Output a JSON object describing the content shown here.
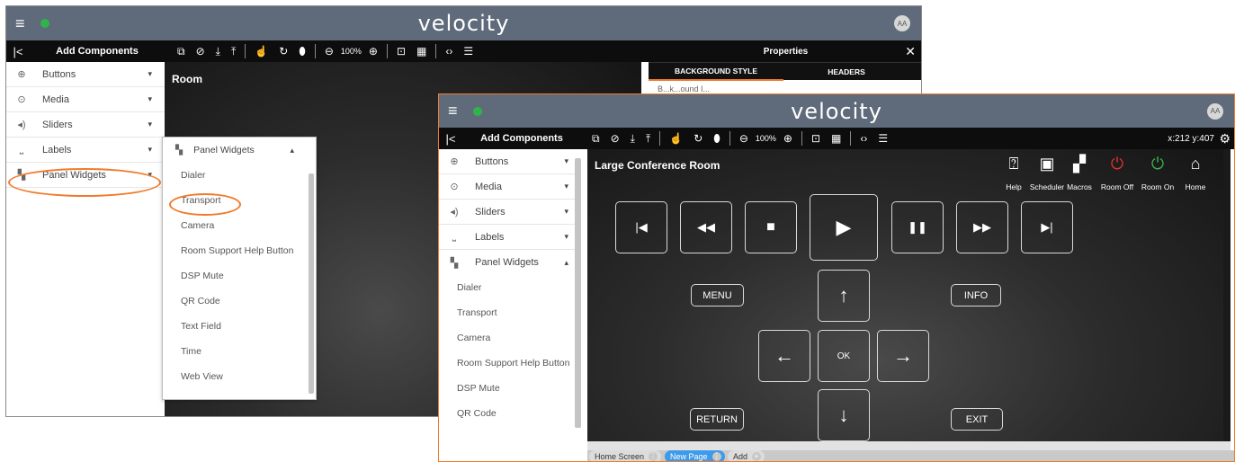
{
  "app": {
    "logo": "velocity",
    "avatar": "AA",
    "menu_glyph": "≡"
  },
  "back_window": {
    "add_components_title": "Add Components",
    "collapse_glyph": "|<",
    "zoom_level": "100%",
    "canvas_title": "Room",
    "properties": {
      "title": "Properties",
      "close_glyph": "✕",
      "tabs": [
        "BACKGROUND STYLE",
        "HEADERS"
      ],
      "partial_text": "B...k...ound I..."
    },
    "sidebar": [
      {
        "label": "Buttons",
        "icon": "plus-circle-icon"
      },
      {
        "label": "Media",
        "icon": "play-circle-icon"
      },
      {
        "label": "Sliders",
        "icon": "volume-icon"
      },
      {
        "label": "Labels",
        "icon": "label-icon"
      },
      {
        "label": "Panel Widgets",
        "icon": "widgets-icon"
      }
    ],
    "popup": {
      "header": "Panel Widgets",
      "items": [
        "Dialer",
        "Transport",
        "Camera",
        "Room Support Help Button",
        "DSP Mute",
        "QR Code",
        "Text Field",
        "Time",
        "Web View"
      ]
    }
  },
  "front_window": {
    "add_components_title": "Add Components",
    "collapse_glyph": "|<",
    "zoom_level": "100%",
    "coords": "x:212 y:407",
    "sidebar": [
      {
        "label": "Buttons",
        "icon": "plus-circle-icon"
      },
      {
        "label": "Media",
        "icon": "play-circle-icon"
      },
      {
        "label": "Sliders",
        "icon": "volume-icon"
      },
      {
        "label": "Labels",
        "icon": "label-icon"
      },
      {
        "label": "Panel Widgets",
        "icon": "widgets-icon"
      }
    ],
    "sub_items": [
      "Dialer",
      "Transport",
      "Camera",
      "Room Support Help Button",
      "DSP Mute",
      "QR Code"
    ],
    "room_title": "Large Conference Room",
    "header_buttons": [
      {
        "label": "Help",
        "icon": "help-icon",
        "color": "#ffffff"
      },
      {
        "label": "Scheduler",
        "icon": "scheduler-icon",
        "color": "#ffffff"
      },
      {
        "label": "Macros",
        "icon": "macros-icon",
        "color": "#ffffff"
      },
      {
        "label": "Room Off",
        "icon": "power-icon",
        "color": "#e2302d"
      },
      {
        "label": "Room On",
        "icon": "power-icon",
        "color": "#3ab34a"
      },
      {
        "label": "Home",
        "icon": "home-icon",
        "color": "#ffffff"
      }
    ],
    "transport_buttons": [
      {
        "name": "skip-back",
        "glyph": "|◀"
      },
      {
        "name": "rewind",
        "glyph": "◀◀"
      },
      {
        "name": "stop",
        "glyph": "■"
      },
      {
        "name": "play",
        "glyph": "▶"
      },
      {
        "name": "pause",
        "glyph": "❚❚"
      },
      {
        "name": "fast-forward",
        "glyph": "▶▶"
      },
      {
        "name": "skip-forward",
        "glyph": "▶|"
      }
    ],
    "nav": {
      "menu": "MENU",
      "info": "INFO",
      "ok": "OK",
      "return": "RETURN",
      "exit": "EXIT",
      "up": "↑",
      "down": "↓",
      "left": "←",
      "right": "→"
    },
    "page_tabs": [
      "Home Screen",
      "New Page",
      "Add"
    ]
  },
  "colors": {
    "accent_orange": "#f07b2c",
    "topbar": "#5f6b7a",
    "tab_active": "#3d9be9"
  }
}
